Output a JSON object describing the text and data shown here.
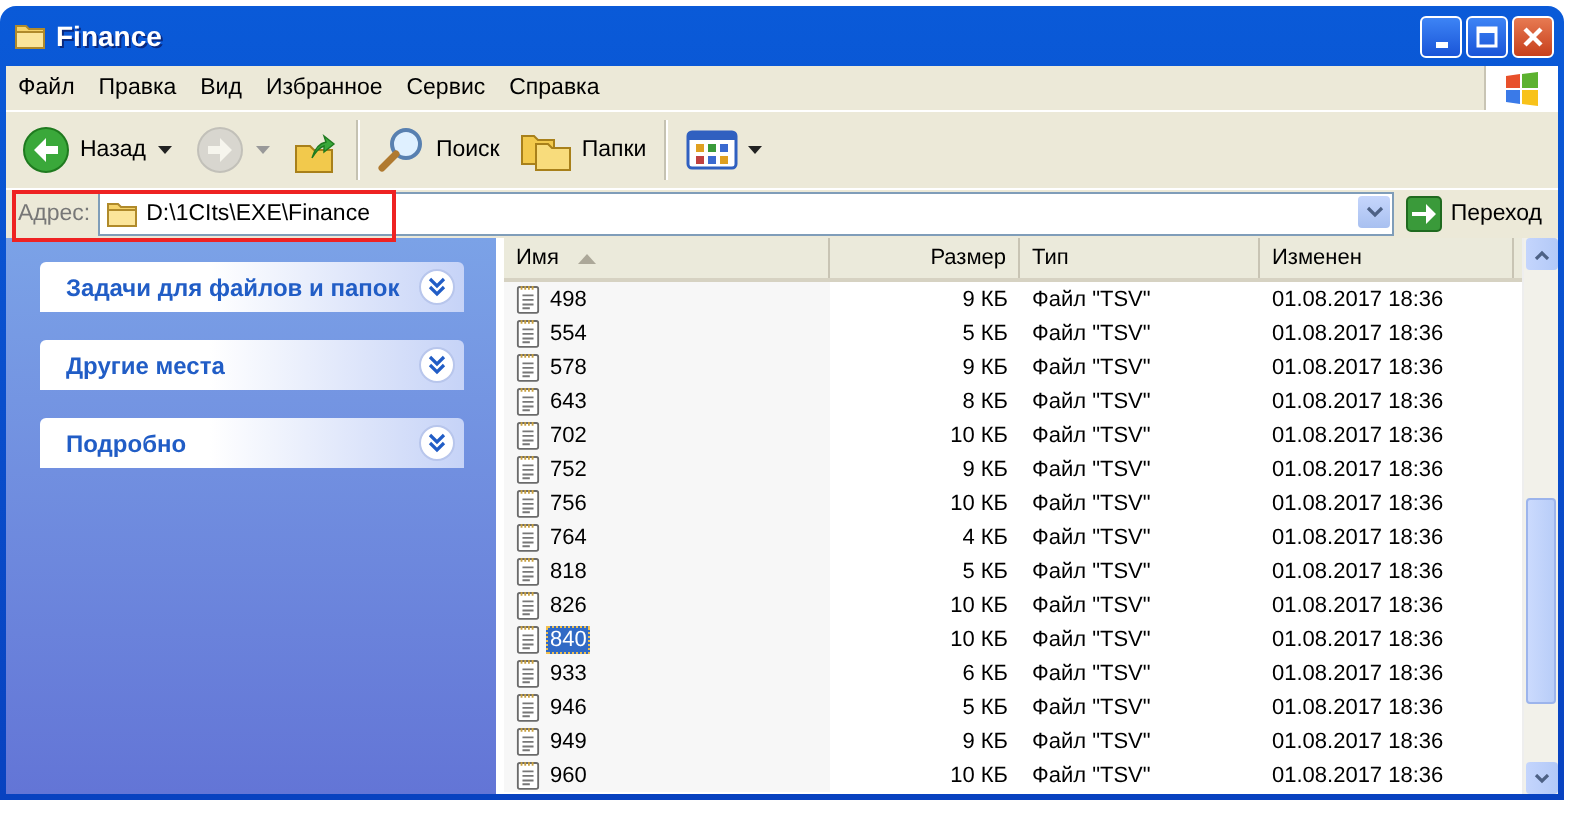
{
  "window": {
    "title": "Finance"
  },
  "menu": [
    "Файл",
    "Правка",
    "Вид",
    "Избранное",
    "Сервис",
    "Справка"
  ],
  "toolbar": {
    "back": {
      "label": "Назад",
      "disabled": false
    },
    "forward": {
      "disabled": true
    },
    "search": "Поиск",
    "folders": "Папки"
  },
  "address": {
    "label": "Адрес:",
    "value": "D:\\1CIts\\EXE\\Finance",
    "highlighted": true,
    "go": "Переход"
  },
  "sidebar": {
    "panels": [
      {
        "title": "Задачи для файлов и папок",
        "expanded": false
      },
      {
        "title": "Другие места",
        "expanded": false
      },
      {
        "title": "Подробно",
        "expanded": false
      }
    ]
  },
  "files": {
    "columns": [
      {
        "label": "Имя",
        "sorted": true
      },
      {
        "label": "Размер",
        "sorted": false
      },
      {
        "label": "Тип",
        "sorted": false
      },
      {
        "label": "Изменен",
        "sorted": false
      }
    ],
    "rows": [
      {
        "name": "498",
        "size": "9 КБ",
        "type": "Файл \"TSV\"",
        "modified": "01.08.2017 18:36",
        "selected": false
      },
      {
        "name": "554",
        "size": "5 КБ",
        "type": "Файл \"TSV\"",
        "modified": "01.08.2017 18:36",
        "selected": false
      },
      {
        "name": "578",
        "size": "9 КБ",
        "type": "Файл \"TSV\"",
        "modified": "01.08.2017 18:36",
        "selected": false
      },
      {
        "name": "643",
        "size": "8 КБ",
        "type": "Файл \"TSV\"",
        "modified": "01.08.2017 18:36",
        "selected": false
      },
      {
        "name": "702",
        "size": "10 КБ",
        "type": "Файл \"TSV\"",
        "modified": "01.08.2017 18:36",
        "selected": false
      },
      {
        "name": "752",
        "size": "9 КБ",
        "type": "Файл \"TSV\"",
        "modified": "01.08.2017 18:36",
        "selected": false
      },
      {
        "name": "756",
        "size": "10 КБ",
        "type": "Файл \"TSV\"",
        "modified": "01.08.2017 18:36",
        "selected": false
      },
      {
        "name": "764",
        "size": "4 КБ",
        "type": "Файл \"TSV\"",
        "modified": "01.08.2017 18:36",
        "selected": false
      },
      {
        "name": "818",
        "size": "5 КБ",
        "type": "Файл \"TSV\"",
        "modified": "01.08.2017 18:36",
        "selected": false
      },
      {
        "name": "826",
        "size": "10 КБ",
        "type": "Файл \"TSV\"",
        "modified": "01.08.2017 18:36",
        "selected": false
      },
      {
        "name": "840",
        "size": "10 КБ",
        "type": "Файл \"TSV\"",
        "modified": "01.08.2017 18:36",
        "selected": true
      },
      {
        "name": "933",
        "size": "6 КБ",
        "type": "Файл \"TSV\"",
        "modified": "01.08.2017 18:36",
        "selected": false
      },
      {
        "name": "946",
        "size": "5 КБ",
        "type": "Файл \"TSV\"",
        "modified": "01.08.2017 18:36",
        "selected": false
      },
      {
        "name": "949",
        "size": "9 КБ",
        "type": "Файл \"TSV\"",
        "modified": "01.08.2017 18:36",
        "selected": false
      },
      {
        "name": "960",
        "size": "10 КБ",
        "type": "Файл \"TSV\"",
        "modified": "01.08.2017 18:36",
        "selected": false
      }
    ]
  }
}
